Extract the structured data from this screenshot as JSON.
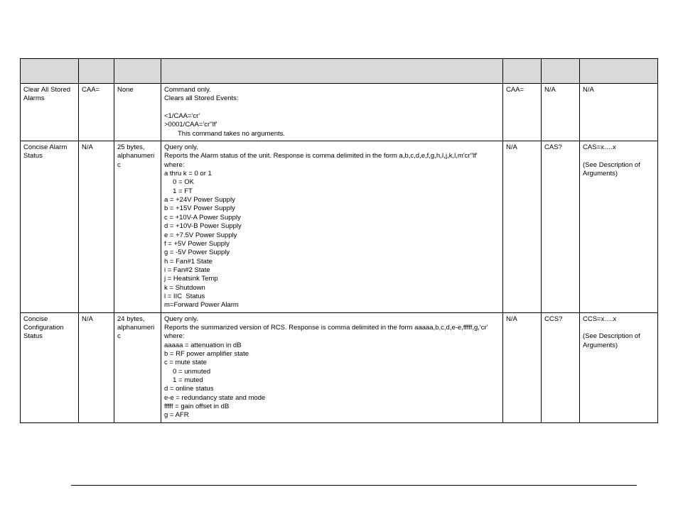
{
  "headers": [
    "",
    "",
    "",
    "",
    "",
    "",
    ""
  ],
  "rows": [
    {
      "param": "Clear All Stored Alarms",
      "cmd": "CAA=",
      "args": "None",
      "desc_lines": [
        "Command only.",
        "Clears all Stored Events:",
        "",
        "<1/CAA='cr'",
        ">0001/CAA='cr''lf'",
        "  This command takes no arguments."
      ],
      "c4": "CAA=",
      "c5": "N/A",
      "c6_lines": [
        "N/A"
      ]
    },
    {
      "param": "Concise Alarm Status",
      "cmd": "N/A",
      "args": "25 bytes, alphanumeric",
      "desc_lines": [
        "Query only.",
        "Reports the Alarm status of the unit. Response is comma delimited in the form a,b,c,d,e,f,g,h,I,j,k,l,m'cr''lf'",
        "where:",
        "a thru k = 0 or 1",
        "  0 = OK",
        "  1 = FT",
        "a = +24V Power Supply",
        "b = +15V Power Supply",
        "c = +10V-A Power Supply",
        "d = +10V-B Power Supply",
        "e = +7.5V Power Supply",
        "f = +5V Power Supply",
        "g = -5V Power Supply",
        "h = Fan#1 State",
        "i = Fan#2 State",
        "j = Heatsink Temp",
        "k = Shutdown",
        "l = IIC  Status",
        "m=Forward Power Alarm"
      ],
      "c4": "N/A",
      "c5": "CAS?",
      "c6_lines": [
        "CAS=x….x",
        "",
        "(See Description of Arguments)"
      ]
    },
    {
      "param": "Concise Configuration Status",
      "cmd": "N/A",
      "args": "24 bytes, alphanumeric",
      "desc_lines": [
        "Query only.",
        "Reports the summarized version of RCS. Response is comma delimited in the form aaaaa,b,c,d,e-e,fffff,g,'cr' where:",
        "aaaaa = attenuation in dB",
        "b = RF power amplifier state",
        "c = mute state",
        "  0 = unmuted",
        "  1 = muted",
        "d = online status",
        "e-e = redundancy state and mode",
        "fffff = gain offset in dB",
        "g = AFR"
      ],
      "c4": "N/A",
      "c5": "CCS?",
      "c6_lines": [
        "CCS=x….x",
        "",
        "(See Description of Arguments)"
      ]
    }
  ]
}
